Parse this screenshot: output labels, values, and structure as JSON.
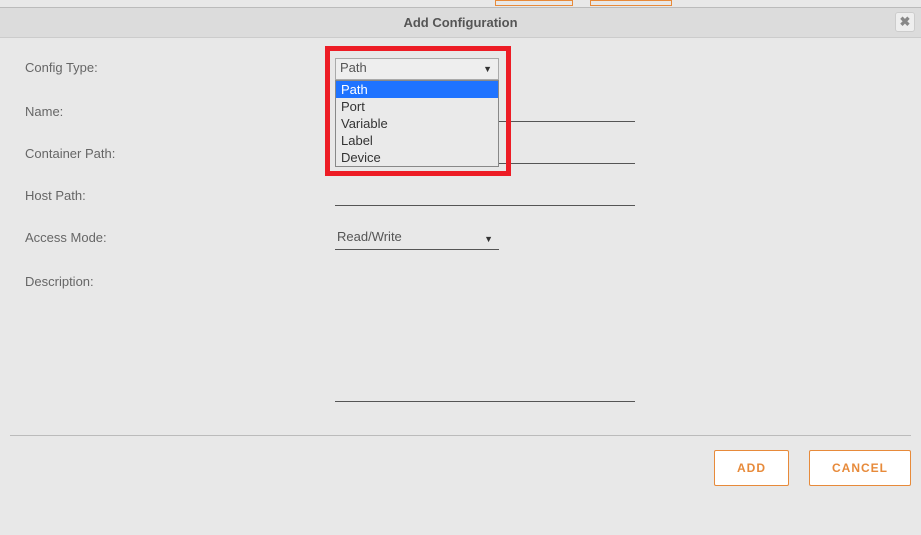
{
  "dialog": {
    "title": "Add Configuration",
    "closeLabel": "✖"
  },
  "labels": {
    "configType": "Config Type:",
    "name": "Name:",
    "containerPath": "Container Path:",
    "hostPath": "Host Path:",
    "accessMode": "Access Mode:",
    "description": "Description:"
  },
  "configType": {
    "selected": "Path",
    "options": [
      "Path",
      "Port",
      "Variable",
      "Label",
      "Device"
    ]
  },
  "accessMode": {
    "selected": "Read/Write"
  },
  "values": {
    "name": "",
    "containerPath": "",
    "hostPath": "",
    "description": ""
  },
  "buttons": {
    "add": "ADD",
    "cancel": "CANCEL"
  }
}
